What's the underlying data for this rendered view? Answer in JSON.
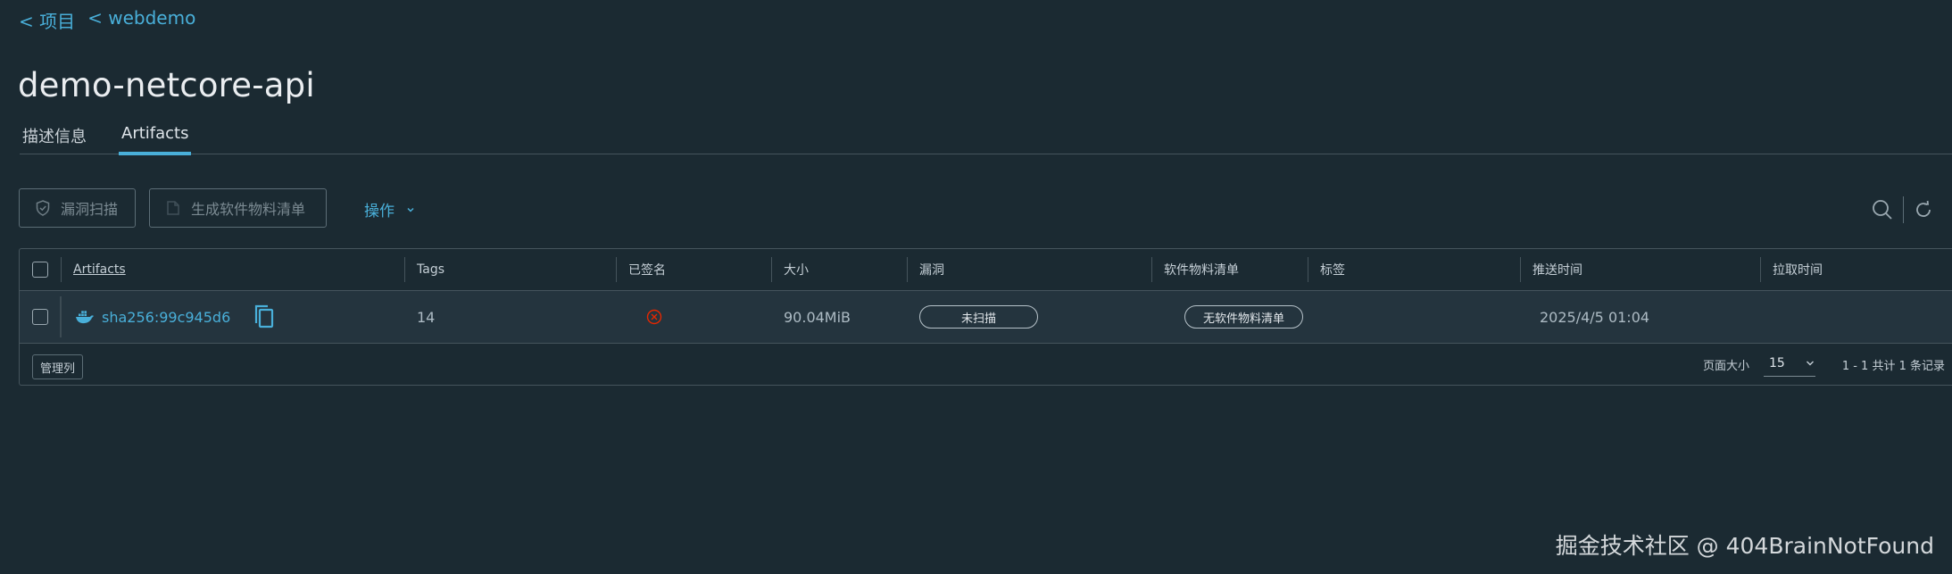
{
  "breadcrumbs": [
    "< 项目",
    "< webdemo"
  ],
  "title": "demo-netcore-api",
  "tabs": [
    {
      "label": "描述信息",
      "active": false
    },
    {
      "label": "Artifacts",
      "active": true
    }
  ],
  "toolbar": {
    "scan_label": "漏洞扫描",
    "sbom_label": "生成软件物料清单",
    "actions_label": "操作"
  },
  "table": {
    "headers": {
      "artifacts": "Artifacts",
      "tags": "Tags",
      "signed": "已签名",
      "size": "大小",
      "vulnerabilities": "漏洞",
      "sbom": "软件物料清单",
      "labels": "标签",
      "push_time": "推送时间",
      "pull_time": "拉取时间"
    },
    "rows": [
      {
        "digest": "sha256:99c945d6",
        "tags": "14",
        "signed_icon": "x-circle-icon",
        "size": "90.04MiB",
        "vulnerabilities": "未扫描",
        "sbom": "无软件物料清单",
        "labels": "",
        "push_time": "2025/4/5 01:04",
        "pull_time": ""
      }
    ],
    "footer": {
      "manage_columns": "管理列",
      "page_size_label": "页面大小",
      "page_size": "15",
      "summary": "1 - 1 共计 1 条记录"
    }
  },
  "colors": {
    "background": "#1b2a32",
    "accent": "#49afd9",
    "error": "#e62700"
  },
  "watermark": "掘金技术社区 @ 404BrainNotFound"
}
